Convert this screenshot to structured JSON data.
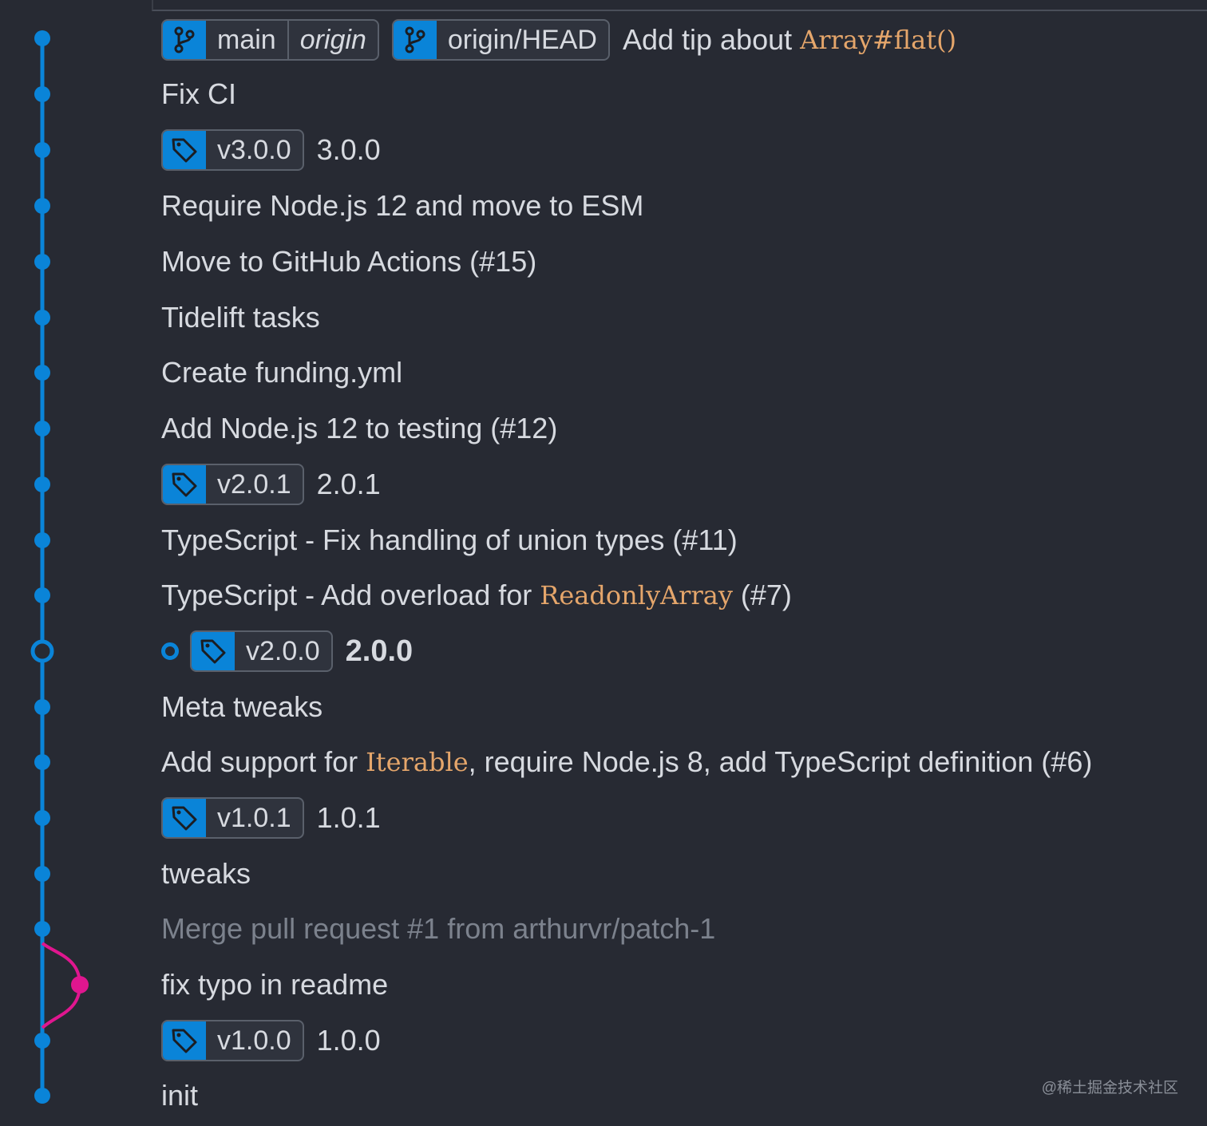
{
  "colors": {
    "background": "#272a33",
    "graph_line": "#0a84d8",
    "merge_branch": "#e0168f",
    "badge_icon_bg": "#0a84d8",
    "code_text": "#e5a66b",
    "dim_text": "#7c828d"
  },
  "commits": {
    "c0": {
      "branch_local": "main",
      "branch_remote": "origin",
      "remote_head": "origin/HEAD",
      "message_prefix": "Add tip about ",
      "message_code": "Array#flat()"
    },
    "c1": {
      "message": "Fix CI"
    },
    "c2": {
      "tag": "v3.0.0",
      "message": "3.0.0"
    },
    "c3": {
      "message": "Require Node.js 12 and move to ESM"
    },
    "c4": {
      "message": "Move to GitHub Actions (#15)"
    },
    "c5": {
      "message": "Tidelift tasks"
    },
    "c6": {
      "message": "Create funding.yml"
    },
    "c7": {
      "message": "Add Node.js 12 to testing (#12)"
    },
    "c8": {
      "tag": "v2.0.1",
      "message": "2.0.1"
    },
    "c9": {
      "message": "TypeScript - Fix handling of union types (#11)"
    },
    "c10": {
      "message_prefix": "TypeScript - Add overload for ",
      "message_code": "ReadonlyArray",
      "message_suffix": " (#7)"
    },
    "c11": {
      "tag": "v2.0.0",
      "message": "2.0.0"
    },
    "c12": {
      "message": "Meta tweaks"
    },
    "c13": {
      "message_prefix": "Add support for ",
      "message_code": "Iterable",
      "message_suffix": ", require Node.js 8, add TypeScript definition (#6)"
    },
    "c14": {
      "tag": "v1.0.1",
      "message": "1.0.1"
    },
    "c15": {
      "message": "tweaks"
    },
    "c16": {
      "message": "Merge pull request #1 from arthurvr/patch-1"
    },
    "c17": {
      "message": "fix typo in readme"
    },
    "c18": {
      "tag": "v1.0.0",
      "message": "1.0.0"
    },
    "c19": {
      "message": "init"
    }
  },
  "watermark": "@稀土掘金技术社区"
}
